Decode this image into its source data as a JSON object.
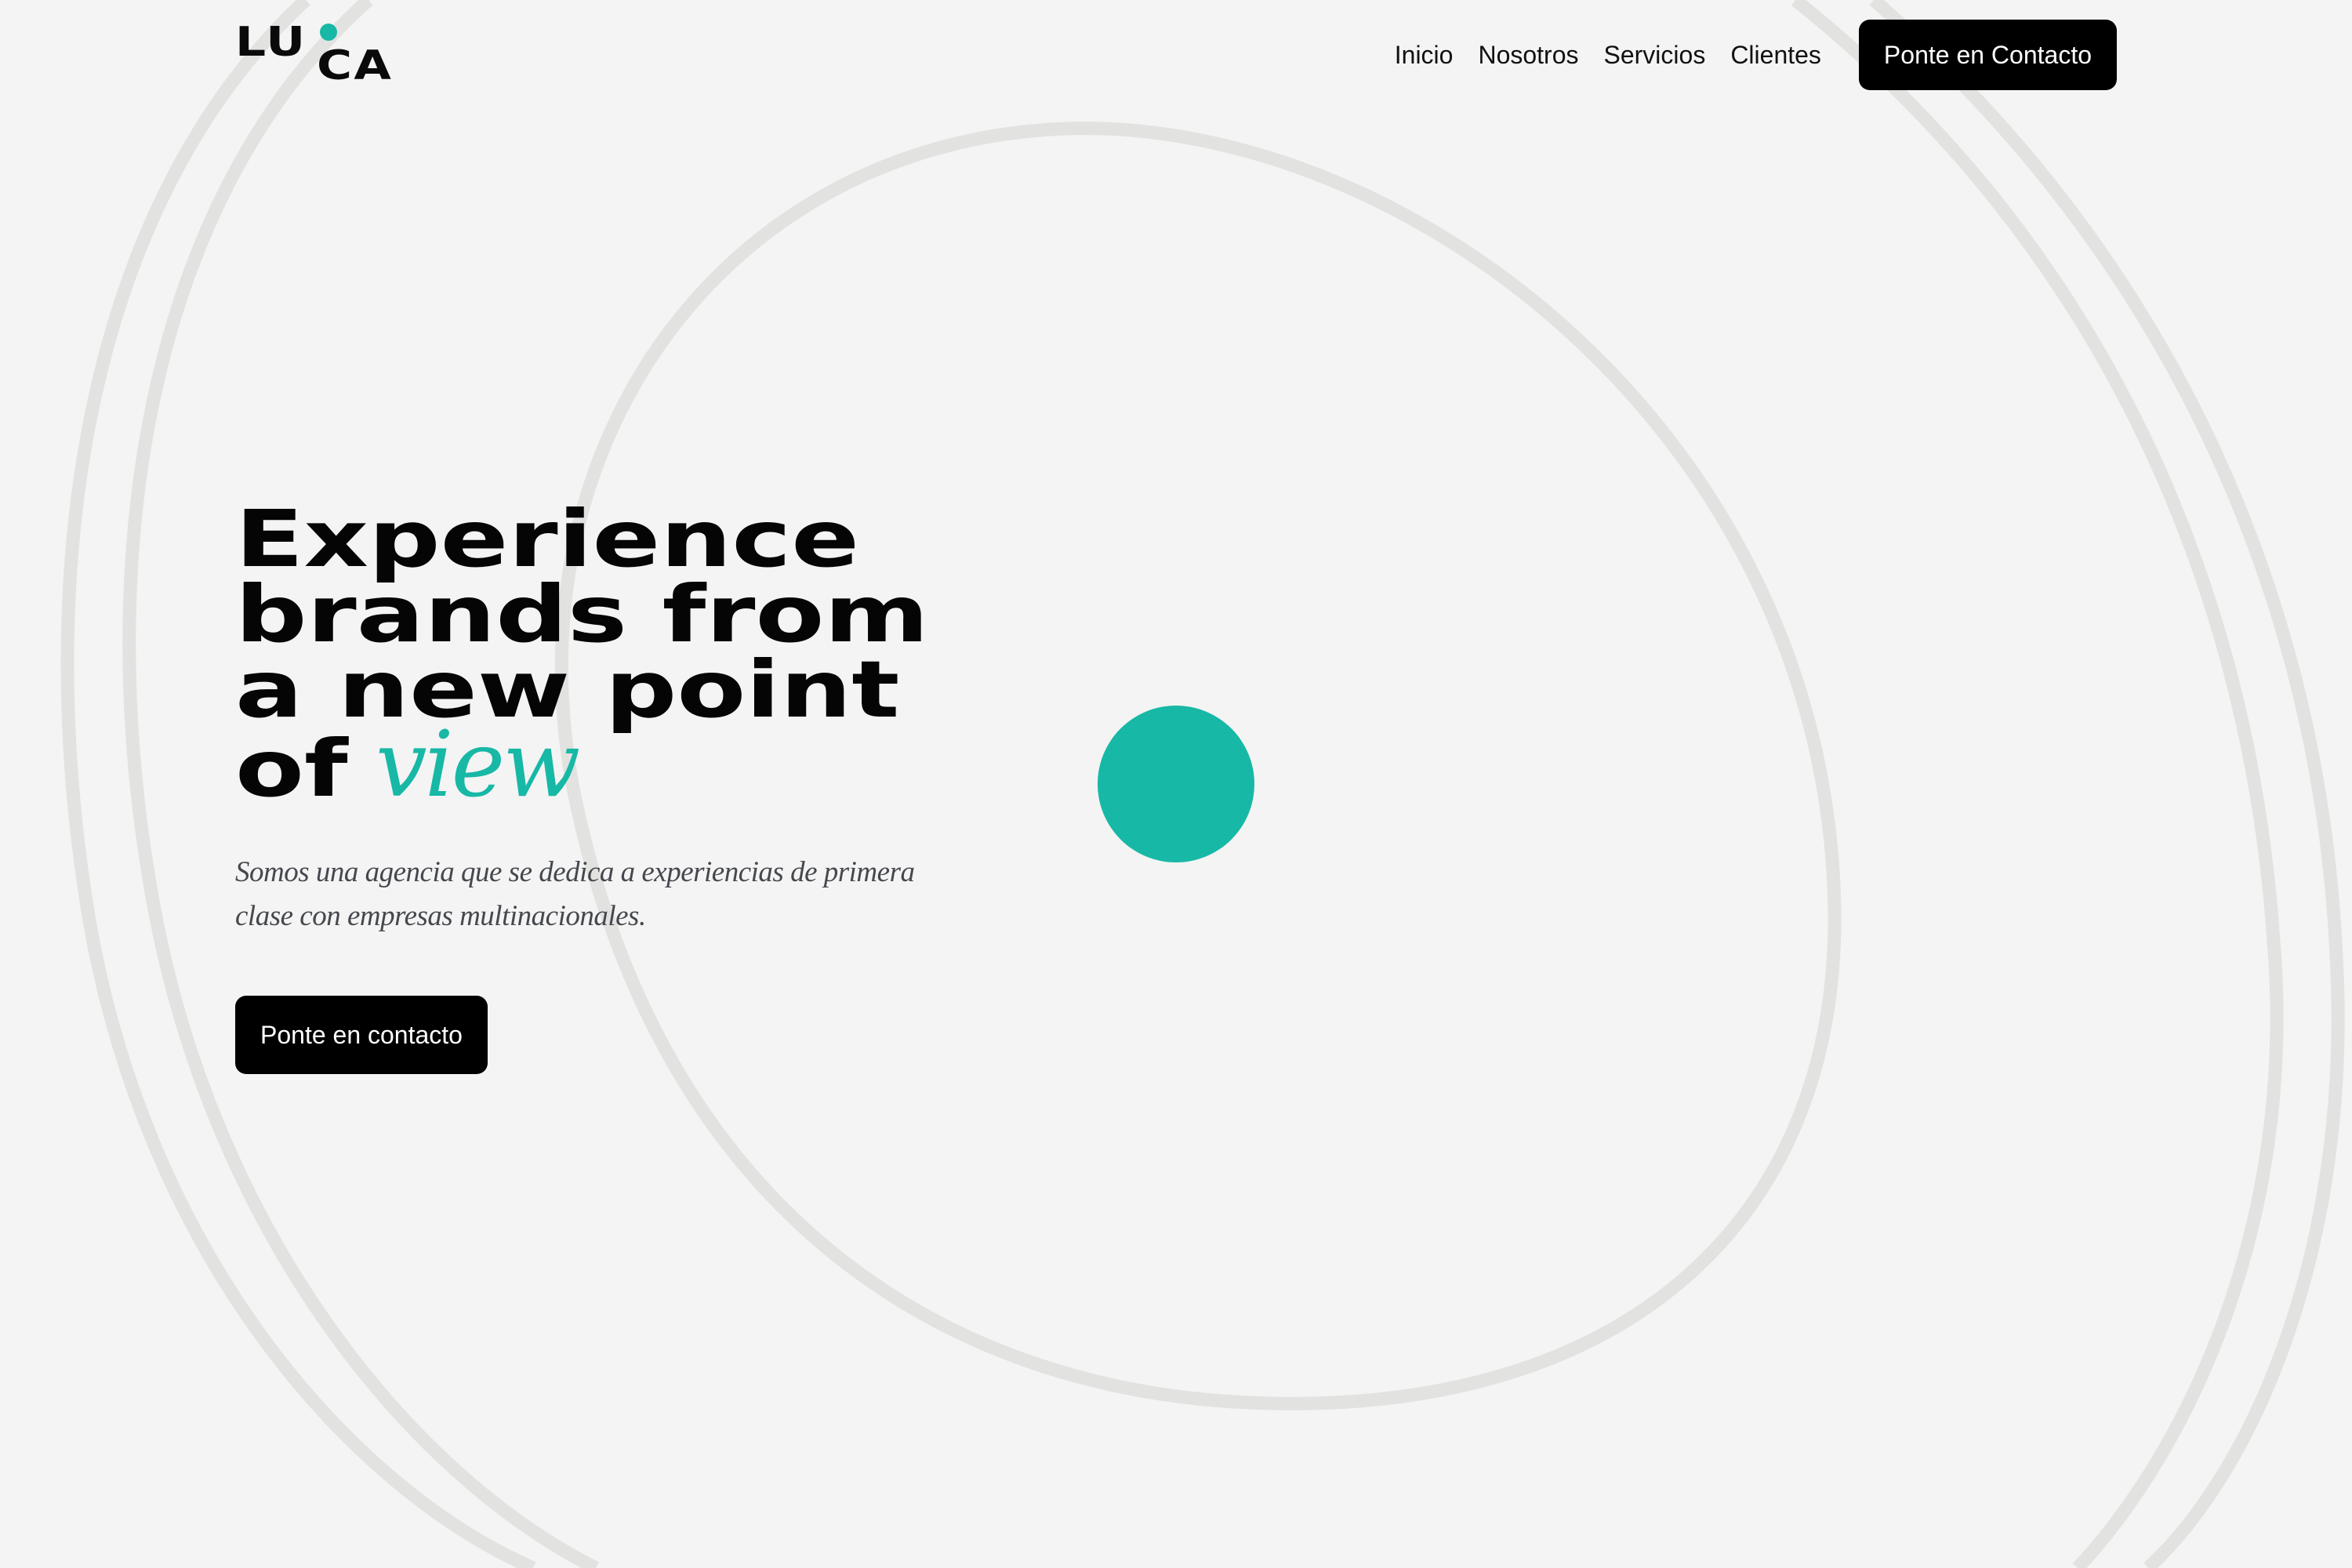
{
  "brand": {
    "logo_top": "LU",
    "logo_bottom": "CA",
    "accent_color": "#17b8a6",
    "dark_color": "#050505",
    "ring_color": "#e2e2e0",
    "background_color": "#f4f4f4"
  },
  "nav": {
    "items": [
      {
        "label": "Inicio"
      },
      {
        "label": "Nosotros"
      },
      {
        "label": "Servicios"
      },
      {
        "label": "Clientes"
      }
    ],
    "cta_label": "Ponte en Contacto"
  },
  "hero": {
    "title_lines": [
      "Experience",
      "brands from",
      "a new point"
    ],
    "title_last_prefix": "of",
    "title_accent_word": "view",
    "subtitle": "Somos una agencia que se dedica a experiencias de primera clase con empresas multinacionales.",
    "cta_label": "Ponte en contacto"
  }
}
